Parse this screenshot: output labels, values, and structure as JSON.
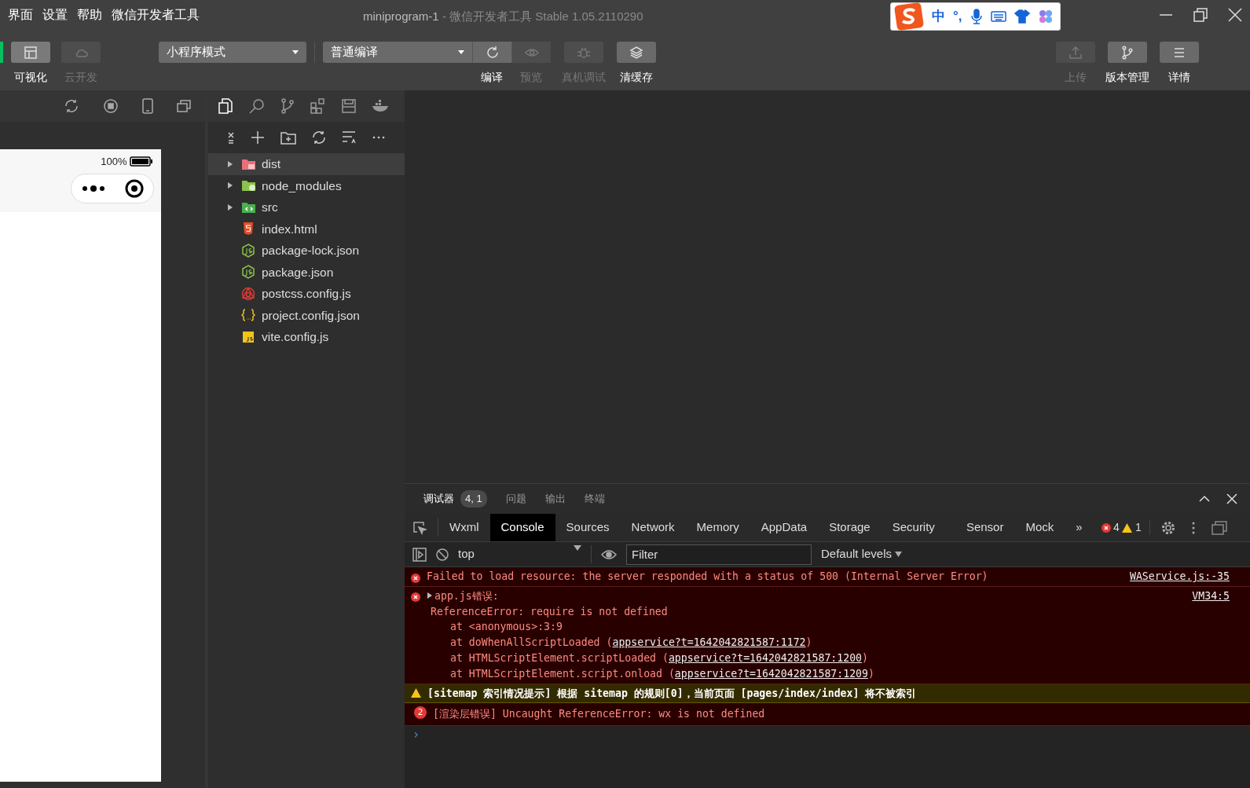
{
  "menu": [
    "界面",
    "设置",
    "帮助",
    "微信开发者工具"
  ],
  "window": {
    "title": "miniprogram-1",
    "subtitle": "- 微信开发者工具 Stable 1.05.2110290"
  },
  "ime_bar": {
    "items": [
      "中",
      "°,"
    ]
  },
  "toolbar": {
    "left": [
      {
        "label": "可视化",
        "disabled": false,
        "selected": true
      },
      {
        "label": "云开发",
        "disabled": true,
        "selected": false
      }
    ],
    "mode": "小程序模式",
    "compile": "普通编译",
    "actions": [
      {
        "label": "编译",
        "disabled": false
      },
      {
        "label": "预览",
        "disabled": true
      },
      {
        "label": "真机调试",
        "disabled": true
      },
      {
        "label": "清缓存",
        "disabled": false
      }
    ],
    "right": [
      {
        "label": "上传",
        "disabled": true
      },
      {
        "label": "版本管理",
        "disabled": false
      },
      {
        "label": "详情",
        "disabled": false
      }
    ]
  },
  "simulator": {
    "battery_text": "100%"
  },
  "explorer": {
    "tree": [
      {
        "name": "dist",
        "kind": "folder-dist",
        "expanded": false,
        "selected": true
      },
      {
        "name": "node_modules",
        "kind": "folder-node",
        "expanded": false,
        "selected": false
      },
      {
        "name": "src",
        "kind": "folder-src",
        "expanded": false,
        "selected": false
      },
      {
        "name": "index.html",
        "kind": "html",
        "selected": false
      },
      {
        "name": "package-lock.json",
        "kind": "node",
        "selected": false
      },
      {
        "name": "package.json",
        "kind": "node",
        "selected": false
      },
      {
        "name": "postcss.config.js",
        "kind": "postcss",
        "selected": false
      },
      {
        "name": "project.config.json",
        "kind": "config",
        "selected": false
      },
      {
        "name": "vite.config.js",
        "kind": "js",
        "selected": false
      }
    ]
  },
  "debug_tabs": [
    {
      "label": "调试器",
      "badge": "4, 1",
      "selected": true
    },
    {
      "label": "问题",
      "selected": false
    },
    {
      "label": "输出",
      "selected": false
    },
    {
      "label": "终端",
      "selected": false
    }
  ],
  "devtools_tabs": [
    {
      "label": "Wxml",
      "selected": false
    },
    {
      "label": "Console",
      "selected": true
    },
    {
      "label": "Sources",
      "selected": false
    },
    {
      "label": "Network",
      "selected": false
    },
    {
      "label": "Memory",
      "selected": false
    },
    {
      "label": "AppData",
      "selected": false
    },
    {
      "label": "Storage",
      "selected": false
    },
    {
      "label": "Security",
      "selected": false
    },
    {
      "label": "Sensor",
      "selected": false
    },
    {
      "label": "Mock",
      "selected": false
    }
  ],
  "more_tabs": "»",
  "error_count": "4",
  "warning_count": "1",
  "console_toolbar": {
    "context": "top",
    "filter_placeholder": "Filter",
    "levels": "Default levels"
  },
  "messages": [
    {
      "kind": "error",
      "text": "Failed to load resource: the server responded with a status of 500 (Internal Server Error)",
      "source": "WAService.js:-35"
    },
    {
      "kind": "error",
      "text": "app.js错误:",
      "expandable": true,
      "source": "VM34:5",
      "detail": "ReferenceError: require is not defined",
      "stack": [
        {
          "text": "at <anonymous>:3:9"
        },
        {
          "text": "at doWhenAllScriptLoaded (",
          "link": "appservice?t=1642042821587:1172",
          "tail": ")"
        },
        {
          "text": "at HTMLScriptElement.scriptLoaded (",
          "link": "appservice?t=1642042821587:1200",
          "tail": ")"
        },
        {
          "text": "at HTMLScriptElement.script.onload (",
          "link": "appservice?t=1642042821587:1209",
          "tail": ")"
        }
      ]
    },
    {
      "kind": "warning",
      "text": "[sitemap 索引情况提示] 根据 sitemap 的规则[0]，当前页面 [pages/index/index] 将不被索引"
    },
    {
      "kind": "repeat-error",
      "count": "2",
      "text": "[渲染层错误] Uncaught ReferenceError: wx is not defined"
    }
  ],
  "prompt": "›"
}
